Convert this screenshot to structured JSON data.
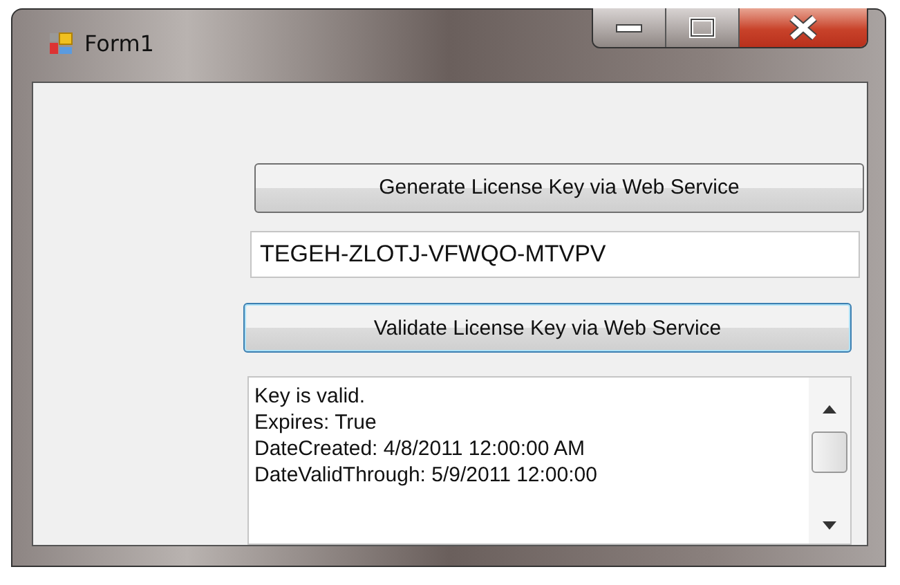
{
  "window": {
    "title": "Form1"
  },
  "generate_button": {
    "label": "Generate License Key via Web Service"
  },
  "key_field": {
    "value": "TEGEH-ZLOTJ-VFWQO-MTVPV"
  },
  "validate_button": {
    "label": "Validate License Key via Web Service",
    "focused": true
  },
  "output_box": {
    "lines": [
      "Key is valid.",
      "Expires: True",
      "DateCreated: 4/8/2011 12:00:00 AM",
      "DateValidThrough: 5/9/2011 12:00:00"
    ]
  }
}
